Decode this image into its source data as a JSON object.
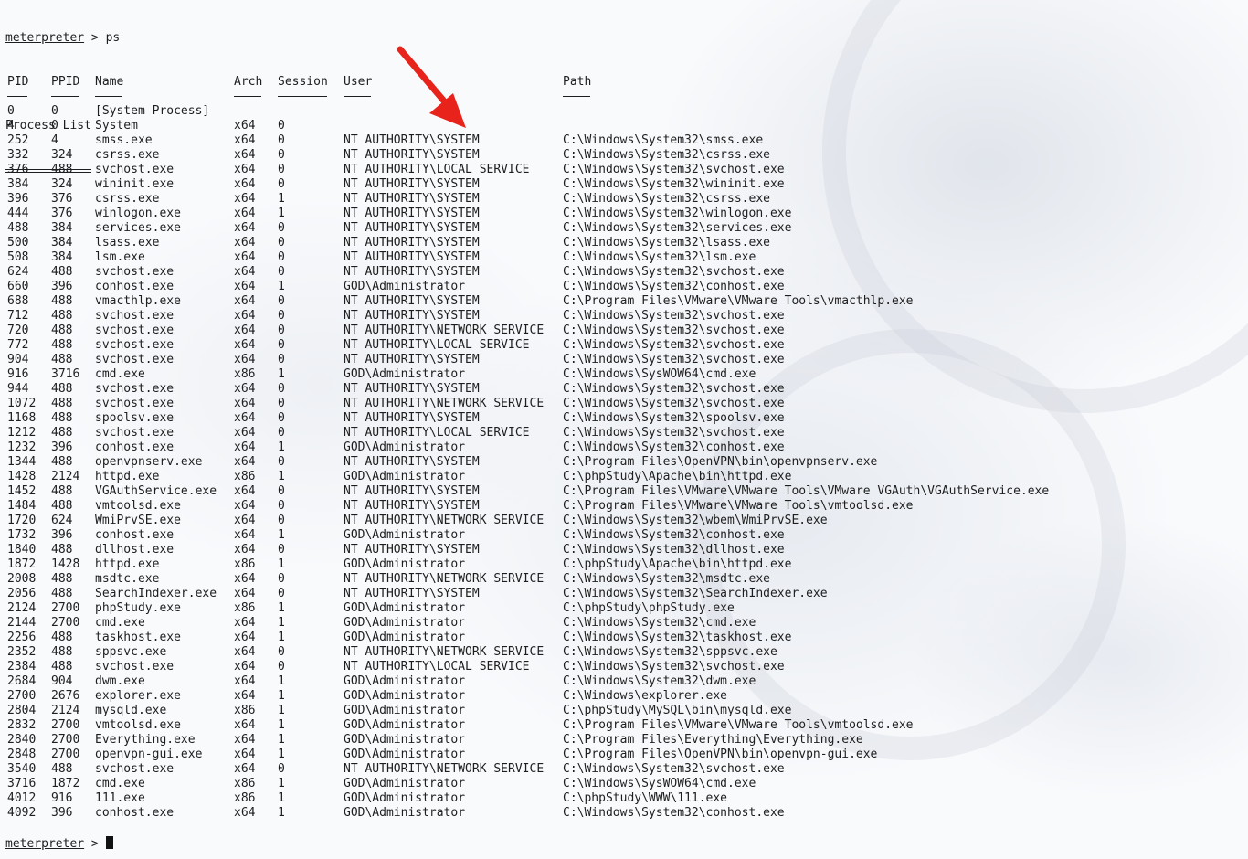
{
  "prompt": {
    "name": "meterpreter",
    "separator": " > ",
    "command": "ps"
  },
  "section_title": "Process List",
  "columns": [
    "PID",
    "PPID",
    "Name",
    "Arch",
    "Session",
    "User",
    "Path"
  ],
  "rows": [
    [
      "0",
      "0",
      "[System Process]",
      "",
      "",
      "",
      ""
    ],
    [
      "4",
      "0",
      "System",
      "x64",
      "0",
      "",
      ""
    ],
    [
      "252",
      "4",
      "smss.exe",
      "x64",
      "0",
      "NT AUTHORITY\\SYSTEM",
      "C:\\Windows\\System32\\smss.exe"
    ],
    [
      "332",
      "324",
      "csrss.exe",
      "x64",
      "0",
      "NT AUTHORITY\\SYSTEM",
      "C:\\Windows\\System32\\csrss.exe"
    ],
    [
      "376",
      "488",
      "svchost.exe",
      "x64",
      "0",
      "NT AUTHORITY\\LOCAL SERVICE",
      "C:\\Windows\\System32\\svchost.exe"
    ],
    [
      "384",
      "324",
      "wininit.exe",
      "x64",
      "0",
      "NT AUTHORITY\\SYSTEM",
      "C:\\Windows\\System32\\wininit.exe"
    ],
    [
      "396",
      "376",
      "csrss.exe",
      "x64",
      "1",
      "NT AUTHORITY\\SYSTEM",
      "C:\\Windows\\System32\\csrss.exe"
    ],
    [
      "444",
      "376",
      "winlogon.exe",
      "x64",
      "1",
      "NT AUTHORITY\\SYSTEM",
      "C:\\Windows\\System32\\winlogon.exe"
    ],
    [
      "488",
      "384",
      "services.exe",
      "x64",
      "0",
      "NT AUTHORITY\\SYSTEM",
      "C:\\Windows\\System32\\services.exe"
    ],
    [
      "500",
      "384",
      "lsass.exe",
      "x64",
      "0",
      "NT AUTHORITY\\SYSTEM",
      "C:\\Windows\\System32\\lsass.exe"
    ],
    [
      "508",
      "384",
      "lsm.exe",
      "x64",
      "0",
      "NT AUTHORITY\\SYSTEM",
      "C:\\Windows\\System32\\lsm.exe"
    ],
    [
      "624",
      "488",
      "svchost.exe",
      "x64",
      "0",
      "NT AUTHORITY\\SYSTEM",
      "C:\\Windows\\System32\\svchost.exe"
    ],
    [
      "660",
      "396",
      "conhost.exe",
      "x64",
      "1",
      "GOD\\Administrator",
      "C:\\Windows\\System32\\conhost.exe"
    ],
    [
      "688",
      "488",
      "vmacthlp.exe",
      "x64",
      "0",
      "NT AUTHORITY\\SYSTEM",
      "C:\\Program Files\\VMware\\VMware Tools\\vmacthlp.exe"
    ],
    [
      "712",
      "488",
      "svchost.exe",
      "x64",
      "0",
      "NT AUTHORITY\\SYSTEM",
      "C:\\Windows\\System32\\svchost.exe"
    ],
    [
      "720",
      "488",
      "svchost.exe",
      "x64",
      "0",
      "NT AUTHORITY\\NETWORK SERVICE",
      "C:\\Windows\\System32\\svchost.exe"
    ],
    [
      "772",
      "488",
      "svchost.exe",
      "x64",
      "0",
      "NT AUTHORITY\\LOCAL SERVICE",
      "C:\\Windows\\System32\\svchost.exe"
    ],
    [
      "904",
      "488",
      "svchost.exe",
      "x64",
      "0",
      "NT AUTHORITY\\SYSTEM",
      "C:\\Windows\\System32\\svchost.exe"
    ],
    [
      "916",
      "3716",
      "cmd.exe",
      "x86",
      "1",
      "GOD\\Administrator",
      "C:\\Windows\\SysWOW64\\cmd.exe"
    ],
    [
      "944",
      "488",
      "svchost.exe",
      "x64",
      "0",
      "NT AUTHORITY\\SYSTEM",
      "C:\\Windows\\System32\\svchost.exe"
    ],
    [
      "1072",
      "488",
      "svchost.exe",
      "x64",
      "0",
      "NT AUTHORITY\\NETWORK SERVICE",
      "C:\\Windows\\System32\\svchost.exe"
    ],
    [
      "1168",
      "488",
      "spoolsv.exe",
      "x64",
      "0",
      "NT AUTHORITY\\SYSTEM",
      "C:\\Windows\\System32\\spoolsv.exe"
    ],
    [
      "1212",
      "488",
      "svchost.exe",
      "x64",
      "0",
      "NT AUTHORITY\\LOCAL SERVICE",
      "C:\\Windows\\System32\\svchost.exe"
    ],
    [
      "1232",
      "396",
      "conhost.exe",
      "x64",
      "1",
      "GOD\\Administrator",
      "C:\\Windows\\System32\\conhost.exe"
    ],
    [
      "1344",
      "488",
      "openvpnserv.exe",
      "x64",
      "0",
      "NT AUTHORITY\\SYSTEM",
      "C:\\Program Files\\OpenVPN\\bin\\openvpnserv.exe"
    ],
    [
      "1428",
      "2124",
      "httpd.exe",
      "x86",
      "1",
      "GOD\\Administrator",
      "C:\\phpStudy\\Apache\\bin\\httpd.exe"
    ],
    [
      "1452",
      "488",
      "VGAuthService.exe",
      "x64",
      "0",
      "NT AUTHORITY\\SYSTEM",
      "C:\\Program Files\\VMware\\VMware Tools\\VMware VGAuth\\VGAuthService.exe"
    ],
    [
      "1484",
      "488",
      "vmtoolsd.exe",
      "x64",
      "0",
      "NT AUTHORITY\\SYSTEM",
      "C:\\Program Files\\VMware\\VMware Tools\\vmtoolsd.exe"
    ],
    [
      "1720",
      "624",
      "WmiPrvSE.exe",
      "x64",
      "0",
      "NT AUTHORITY\\NETWORK SERVICE",
      "C:\\Windows\\System32\\wbem\\WmiPrvSE.exe"
    ],
    [
      "1732",
      "396",
      "conhost.exe",
      "x64",
      "1",
      "GOD\\Administrator",
      "C:\\Windows\\System32\\conhost.exe"
    ],
    [
      "1840",
      "488",
      "dllhost.exe",
      "x64",
      "0",
      "NT AUTHORITY\\SYSTEM",
      "C:\\Windows\\System32\\dllhost.exe"
    ],
    [
      "1872",
      "1428",
      "httpd.exe",
      "x86",
      "1",
      "GOD\\Administrator",
      "C:\\phpStudy\\Apache\\bin\\httpd.exe"
    ],
    [
      "2008",
      "488",
      "msdtc.exe",
      "x64",
      "0",
      "NT AUTHORITY\\NETWORK SERVICE",
      "C:\\Windows\\System32\\msdtc.exe"
    ],
    [
      "2056",
      "488",
      "SearchIndexer.exe",
      "x64",
      "0",
      "NT AUTHORITY\\SYSTEM",
      "C:\\Windows\\System32\\SearchIndexer.exe"
    ],
    [
      "2124",
      "2700",
      "phpStudy.exe",
      "x86",
      "1",
      "GOD\\Administrator",
      "C:\\phpStudy\\phpStudy.exe"
    ],
    [
      "2144",
      "2700",
      "cmd.exe",
      "x64",
      "1",
      "GOD\\Administrator",
      "C:\\Windows\\System32\\cmd.exe"
    ],
    [
      "2256",
      "488",
      "taskhost.exe",
      "x64",
      "1",
      "GOD\\Administrator",
      "C:\\Windows\\System32\\taskhost.exe"
    ],
    [
      "2352",
      "488",
      "sppsvc.exe",
      "x64",
      "0",
      "NT AUTHORITY\\NETWORK SERVICE",
      "C:\\Windows\\System32\\sppsvc.exe"
    ],
    [
      "2384",
      "488",
      "svchost.exe",
      "x64",
      "0",
      "NT AUTHORITY\\LOCAL SERVICE",
      "C:\\Windows\\System32\\svchost.exe"
    ],
    [
      "2684",
      "904",
      "dwm.exe",
      "x64",
      "1",
      "GOD\\Administrator",
      "C:\\Windows\\System32\\dwm.exe"
    ],
    [
      "2700",
      "2676",
      "explorer.exe",
      "x64",
      "1",
      "GOD\\Administrator",
      "C:\\Windows\\explorer.exe"
    ],
    [
      "2804",
      "2124",
      "mysqld.exe",
      "x86",
      "1",
      "GOD\\Administrator",
      "C:\\phpStudy\\MySQL\\bin\\mysqld.exe"
    ],
    [
      "2832",
      "2700",
      "vmtoolsd.exe",
      "x64",
      "1",
      "GOD\\Administrator",
      "C:\\Program Files\\VMware\\VMware Tools\\vmtoolsd.exe"
    ],
    [
      "2840",
      "2700",
      "Everything.exe",
      "x64",
      "1",
      "GOD\\Administrator",
      "C:\\Program Files\\Everything\\Everything.exe"
    ],
    [
      "2848",
      "2700",
      "openvpn-gui.exe",
      "x64",
      "1",
      "GOD\\Administrator",
      "C:\\Program Files\\OpenVPN\\bin\\openvpn-gui.exe"
    ],
    [
      "3540",
      "488",
      "svchost.exe",
      "x64",
      "0",
      "NT AUTHORITY\\NETWORK SERVICE",
      "C:\\Windows\\System32\\svchost.exe"
    ],
    [
      "3716",
      "1872",
      "cmd.exe",
      "x86",
      "1",
      "GOD\\Administrator",
      "C:\\Windows\\SysWOW64\\cmd.exe"
    ],
    [
      "4012",
      "916",
      "111.exe",
      "x86",
      "1",
      "GOD\\Administrator",
      "C:\\phpStudy\\WWW\\111.exe"
    ],
    [
      "4092",
      "396",
      "conhost.exe",
      "x64",
      "1",
      "GOD\\Administrator",
      "C:\\Windows\\System32\\conhost.exe"
    ]
  ],
  "annotation": {
    "icon": "red-arrow-icon",
    "color": "#e8231b"
  },
  "colors": {
    "text": "#1e1e1e",
    "background": "#ffffff"
  }
}
